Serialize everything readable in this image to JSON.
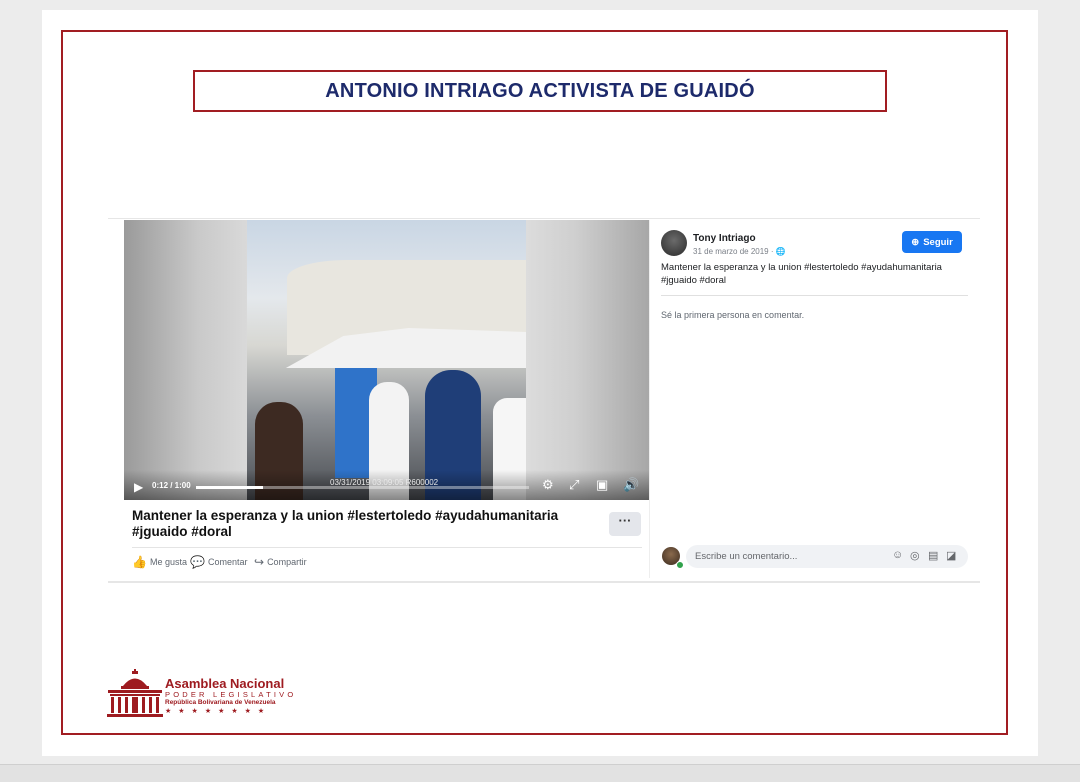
{
  "slide": {
    "title": "ANTONIO INTRIAGO ACTIVISTA DE GUAIDÓ",
    "frame_color": "#a11d22",
    "title_color": "#1d2a6b"
  },
  "video": {
    "time": "0:12 / 1:00",
    "progress_fraction": 0.2,
    "overlay_stamp": "03/31/2019  03:09:05  R600002"
  },
  "post_main": {
    "caption": "Mantener la esperanza y la union #lestertoledo #ayudahumanitaria #jguaido #doral",
    "more_label": "···",
    "actions": {
      "like": "Me gusta",
      "comment": "Comentar",
      "share": "Compartir"
    }
  },
  "post_panel": {
    "author": "Tony Intriago",
    "date": "31 de marzo de 2019 · ",
    "follow_label": "Seguir",
    "text": "Mantener la esperanza y la union #lestertoledo #ayudahumanitaria #jguaido #doral",
    "first_comment": "Sé la primera persona en comentar.",
    "comment_placeholder": "Escribe un comentario..."
  },
  "footer": {
    "org_name": "Asamblea Nacional",
    "org_sub": "PODER LEGISLATIVO",
    "org_country": "República Bolivariana de Venezuela",
    "stars": "★★★★★★★★",
    "accent_color": "#9e1b20"
  },
  "colors": {
    "facebook_blue": "#1877f2"
  }
}
